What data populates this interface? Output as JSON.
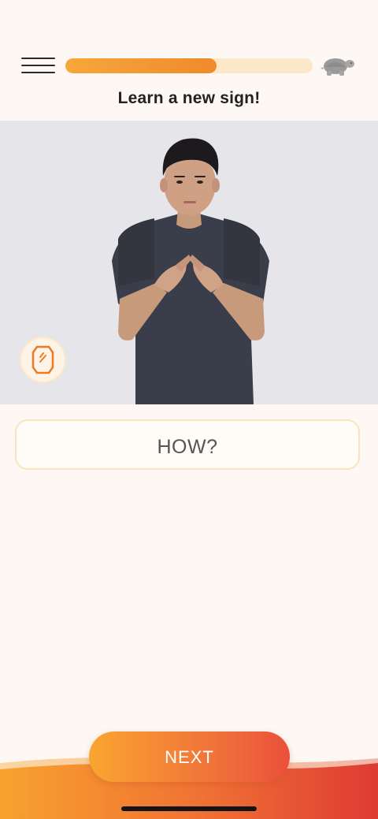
{
  "header": {
    "menu_icon": "hamburger-menu-icon",
    "progress_fraction": 0.61,
    "speed_icon": "turtle-slow-speed-icon",
    "title": "Learn a new sign!"
  },
  "video": {
    "badge_icon": "slow-motion-hand-icon"
  },
  "answer": {
    "text": "HOW?"
  },
  "footer": {
    "next_label": "NEXT"
  },
  "colors": {
    "background": "#fdf8f3",
    "accent_orange": "#f7a73a",
    "accent_red": "#ea4f3b",
    "progress_track": "#fce8c9"
  }
}
